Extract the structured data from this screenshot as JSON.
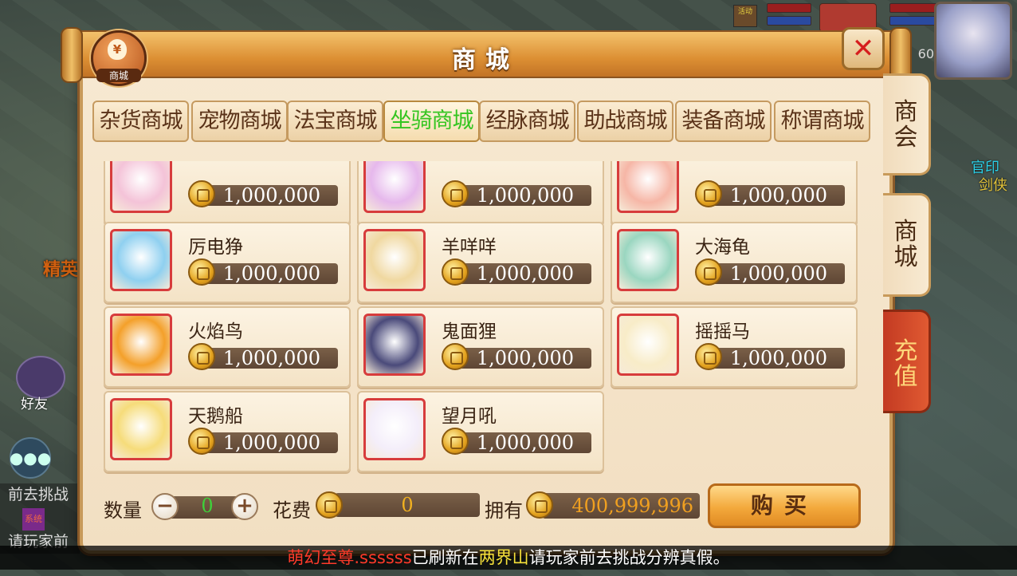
{
  "window": {
    "title": "商城",
    "badge_label": "商城",
    "badge_symbol": "¥"
  },
  "tabs": [
    {
      "label": "杂货商城",
      "active": false
    },
    {
      "label": "宠物商城",
      "active": false
    },
    {
      "label": "法宝商城",
      "active": false
    },
    {
      "label": "坐骑商城",
      "active": true
    },
    {
      "label": "经脉商城",
      "active": false
    },
    {
      "label": "助战商城",
      "active": false
    },
    {
      "label": "装备商城",
      "active": false
    },
    {
      "label": "称谓商城",
      "active": false
    }
  ],
  "side_tabs": [
    {
      "label_top": "商",
      "label_bottom": "会"
    },
    {
      "label_top": "商",
      "label_bottom": "城"
    },
    {
      "label_top": "充",
      "label_bottom": "值"
    }
  ],
  "items": [
    {
      "name": "",
      "price": "1,000,000",
      "color": "#f4c3d8"
    },
    {
      "name": "",
      "price": "1,000,000",
      "color": "#e6b8ec"
    },
    {
      "name": "",
      "price": "1,000,000",
      "color": "#f6b6a6"
    },
    {
      "name": "厉电狰",
      "price": "1,000,000",
      "color": "#8fd0f0"
    },
    {
      "name": "羊咩咩",
      "price": "1,000,000",
      "color": "#f0d8a0"
    },
    {
      "name": "大海龟",
      "price": "1,000,000",
      "color": "#9ad6c0"
    },
    {
      "name": "火焰鸟",
      "price": "1,000,000",
      "color": "#f4a02a"
    },
    {
      "name": "鬼面狸",
      "price": "1,000,000",
      "color": "#4a4a7a"
    },
    {
      "name": "摇摇马",
      "price": "1,000,000",
      "color": "#f8ecc8"
    },
    {
      "name": "天鹅船",
      "price": "1,000,000",
      "color": "#f6dc7a"
    },
    {
      "name": "望月吼",
      "price": "1,000,000",
      "color": "#f4eefa"
    }
  ],
  "footer": {
    "qty_label": "数量",
    "qty_value": "0",
    "minus": "−",
    "plus": "+",
    "cost_label": "花费",
    "cost_value": "0",
    "own_label": "拥有",
    "own_value": "400,999,996",
    "buy_label": "购买"
  },
  "marquee": {
    "name": "萌幻至尊.ssssss",
    "mid": "已刷新在",
    "place": "两界山",
    "tail": "请玩家前去挑战分辨真假。"
  },
  "hud": {
    "level": "60",
    "world_name": "精英",
    "world_label_a": "官印",
    "world_label_b": "剑侠",
    "friend_label": "好友",
    "chat_lines": [
      "前去挑战",
      "系统",
      "请玩家前"
    ]
  }
}
